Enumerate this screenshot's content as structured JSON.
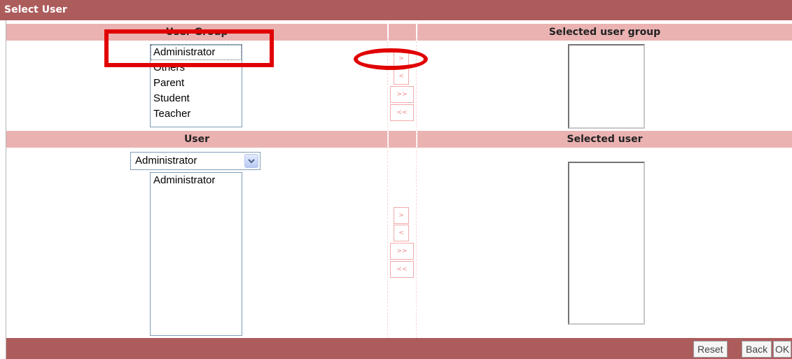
{
  "window": {
    "title": "Select User"
  },
  "user_group_section": {
    "header": "User Group",
    "selected_header": "Selected user group",
    "options": [
      "Administrator",
      "Others",
      "Parent",
      "Student",
      "Teacher"
    ],
    "selected_options": []
  },
  "move_buttons": {
    "add": ">",
    "remove": "<",
    "add_all": ">>",
    "remove_all": "<<"
  },
  "user_section": {
    "header": "User",
    "selected_header": "Selected user",
    "group_select_value": "Administrator",
    "options": [
      "Administrator"
    ],
    "selected_options": []
  },
  "footer": {
    "reset": "Reset",
    "back": "Back",
    "ok": "OK"
  },
  "colors": {
    "titlebar": "#ad5c5c",
    "header": "#ebb2b2",
    "annotation": "#e10000"
  }
}
